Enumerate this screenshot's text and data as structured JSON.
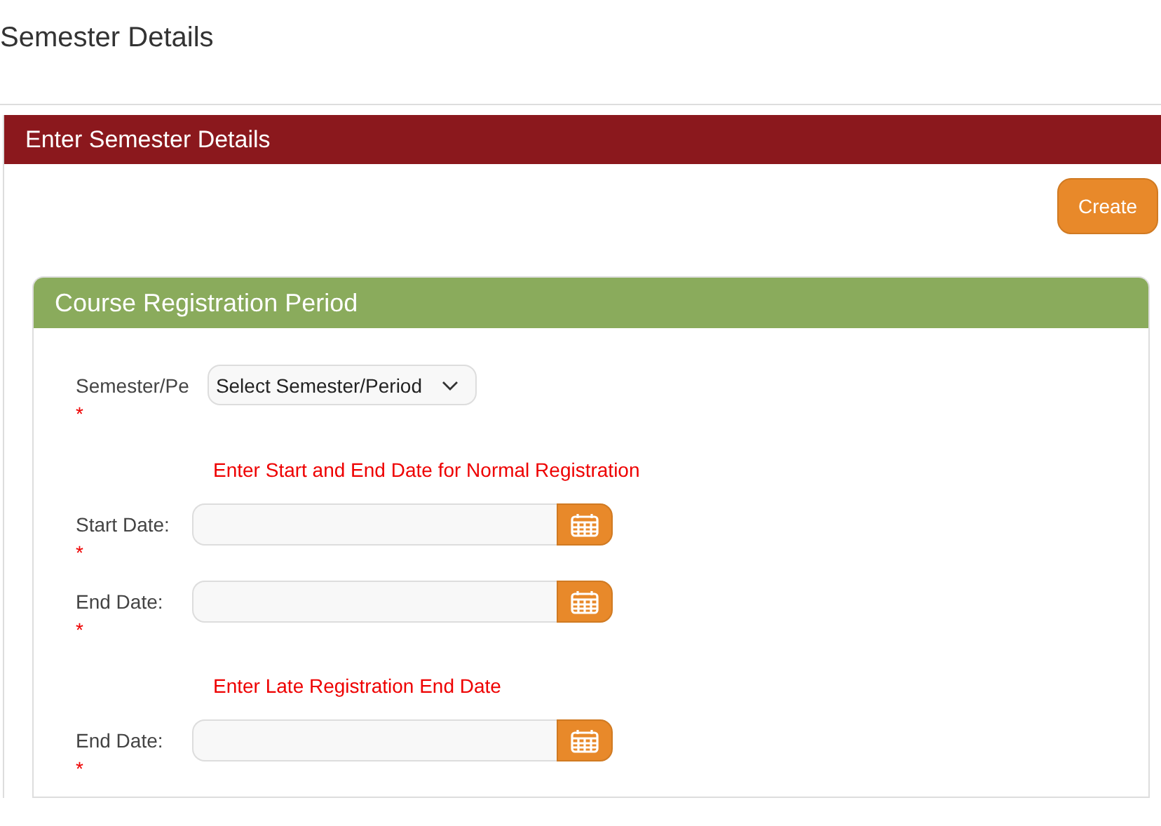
{
  "page_title": "Semester Details",
  "panel": {
    "title": "Enter Semester Details",
    "create_button": "Create"
  },
  "card": {
    "title": "Course Registration Period",
    "rows": [
      {
        "kind": "select",
        "label": "Semester/Pe",
        "required_mark": "*",
        "value": "Select Semester/Period"
      },
      {
        "kind": "note",
        "text": "Enter Start and End Date for Normal Registration"
      },
      {
        "kind": "date",
        "label": "Start Date:",
        "required_mark": "*"
      },
      {
        "kind": "date",
        "label": "End Date:",
        "required_mark": "*"
      },
      {
        "kind": "note",
        "text": "Enter Late Registration End Date"
      },
      {
        "kind": "date",
        "label": "End Date:",
        "required_mark": "*"
      }
    ]
  }
}
